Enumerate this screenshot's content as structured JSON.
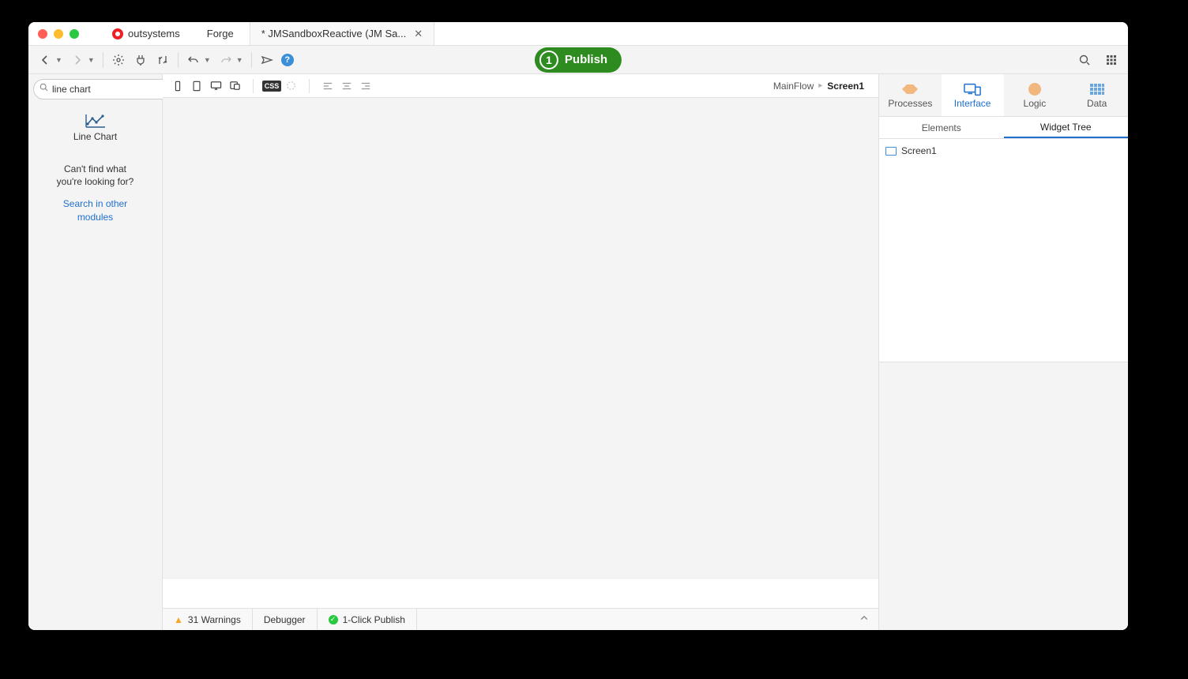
{
  "brand": "outsystems",
  "tabs": {
    "forge": "Forge",
    "document": "* JMSandboxReactive (JM Sa..."
  },
  "publish": {
    "step": "1",
    "label": "Publish"
  },
  "search": {
    "value": "line chart"
  },
  "widget_result": {
    "label": "Line Chart"
  },
  "left": {
    "cant_find_l1": "Can't find what",
    "cant_find_l2": "you're looking for?",
    "search_link_l1": "Search in other",
    "search_link_l2": "modules"
  },
  "breadcrumb": {
    "flow": "MainFlow",
    "screen": "Screen1"
  },
  "right": {
    "processes": "Processes",
    "interface": "Interface",
    "logic": "Logic",
    "data": "Data",
    "elements": "Elements",
    "widget_tree": "Widget Tree",
    "tree_root": "Screen1"
  },
  "status": {
    "warnings_count": "31",
    "warnings_label": "Warnings",
    "debugger": "Debugger",
    "publish": "1-Click Publish"
  }
}
